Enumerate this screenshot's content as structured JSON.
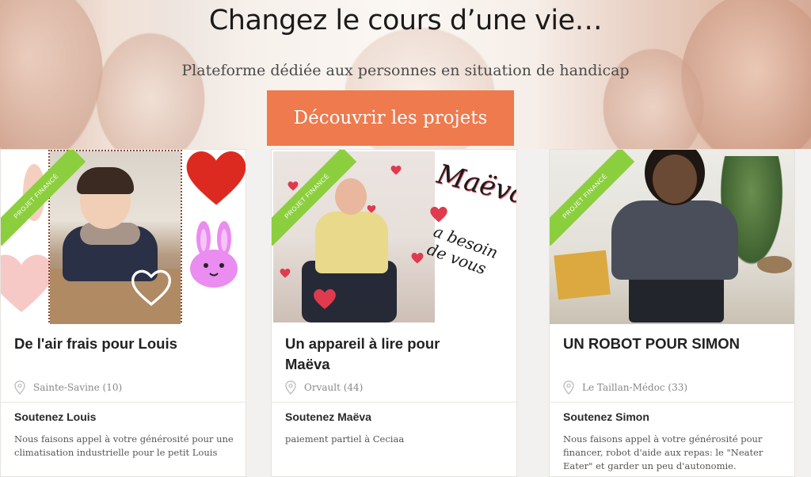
{
  "hero": {
    "title": "Changez le cours d’une vie…",
    "subtitle": "Plateforme dédiée aux personnes en situation de handicap",
    "cta_label": "Découvrir les projets"
  },
  "colors": {
    "cta": "#ee7a4e",
    "ribbon": "#8ccf3e"
  },
  "cards": [
    {
      "ribbon": "PROJET FINANCÉ",
      "title": "De l'air frais pour Louis",
      "location": "Sainte-Savine (10)",
      "support": "Soutenez Louis",
      "description": "Nous faisons appel à votre générosité pour une climatisation industrielle pour le petit Louis"
    },
    {
      "ribbon": "PROJET FINANCÉ",
      "title": "Un appareil à lire pour Maëva",
      "location": "Orvault (44)",
      "support": "Soutenez Maëva",
      "description": "paiement partiel à Ceciaa",
      "image_text_1": "Maëva",
      "image_text_2": "a besoin de vous"
    },
    {
      "ribbon": "PROJET FINANCÉ",
      "title": "UN ROBOT POUR SIMON",
      "location": "Le Taillan-Médoc (33)",
      "support": "Soutenez Simon",
      "description": "Nous faisons appel à votre générosité pour financer, robot d'aide aux repas: le \"Neater Eater\" et garder un peu d'autonomie."
    }
  ],
  "icons": {
    "location": "map-pin-icon",
    "heart": "heart-icon",
    "bunny": "bunny-icon"
  }
}
